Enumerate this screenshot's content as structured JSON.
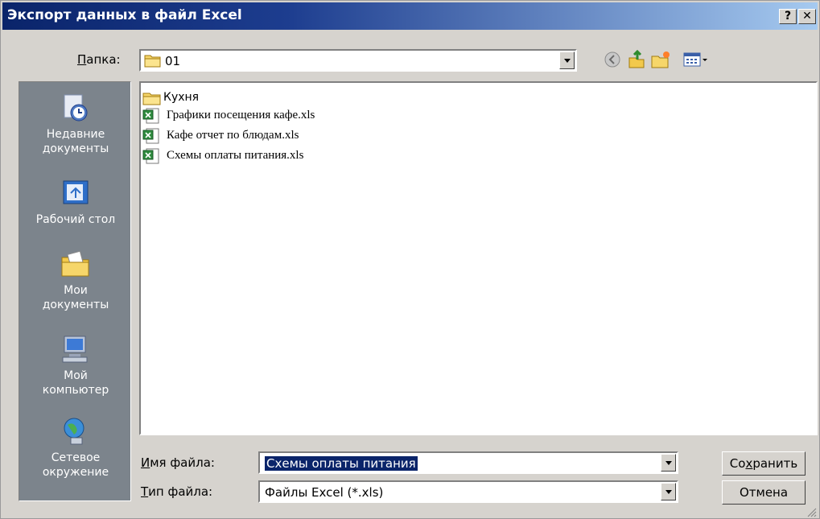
{
  "window": {
    "title": "Экспорт данных в файл Excel",
    "help_label": "?",
    "close_label": "✕"
  },
  "folder": {
    "label_prefix": "",
    "label_hot": "П",
    "label_rest": "апка:",
    "value": "01"
  },
  "places": [
    {
      "icon": "recent-documents-icon",
      "line1": "Недавние",
      "line2": "документы"
    },
    {
      "icon": "desktop-icon",
      "line1": "Рабочий стол",
      "line2": ""
    },
    {
      "icon": "my-documents-icon",
      "line1": "Мои",
      "line2": "документы"
    },
    {
      "icon": "my-computer-icon",
      "line1": "Мой",
      "line2": "компьютер"
    },
    {
      "icon": "network-icon",
      "line1": "Сетевое",
      "line2": "окружение"
    }
  ],
  "files": [
    {
      "type": "folder",
      "name": "Кухня"
    },
    {
      "type": "xls",
      "name": "Графики посещения кафе.xls"
    },
    {
      "type": "xls",
      "name": "Кафе отчет по блюдам.xls"
    },
    {
      "type": "xls",
      "name": "Схемы оплаты питания.xls"
    }
  ],
  "filename": {
    "hot": "И",
    "rest": "мя файла:",
    "value": "Схемы оплаты питания"
  },
  "filetype": {
    "hot": "Т",
    "rest": "ип файла:",
    "value": "Файлы Excel (*.xls)"
  },
  "buttons": {
    "save_pre": "Со",
    "save_hot": "х",
    "save_post": "ранить",
    "cancel": "Отмена"
  },
  "colors": {
    "title_start": "#0a246a",
    "places_bg": "#7c848c",
    "dialog_bg": "#d6d3ce"
  }
}
